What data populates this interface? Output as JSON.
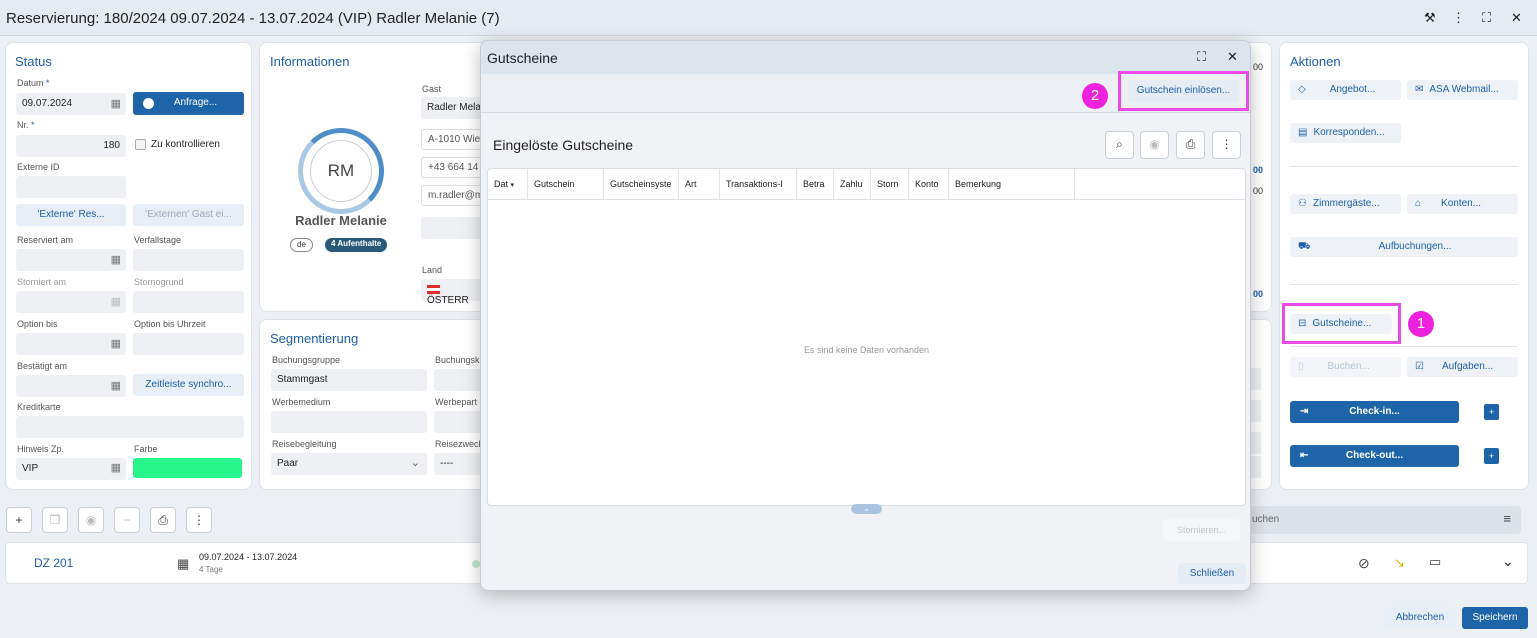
{
  "window": {
    "title": "Reservierung: 180/2024 09.07.2024 - 13.07.2024 (VIP) Radler Melanie (7)"
  },
  "status": {
    "title": "Status",
    "datum_label": "Datum",
    "datum": "09.07.2024",
    "anfrage": "Anfrage...",
    "nr_label": "Nr.",
    "nr": "180",
    "zu_kontrollieren": "Zu kontrollieren",
    "externe_id_label": "Externe ID",
    "externe_res": "'Externe' Res...",
    "externen_gast": "'Externen' Gast ei...",
    "reserviert_am": "Reserviert am",
    "verfallstage": "Verfallstage",
    "storniert_am": "Storniert am",
    "stornogrund": "Stornogrund",
    "option_bis": "Option bis",
    "option_bis_uhrzeit": "Option bis Uhrzeit",
    "bestaetigt_am": "Bestätigt am",
    "zeitleiste": "Zeitleiste synchro...",
    "kreditkarte": "Kreditkarte",
    "hinweis_zp": "Hinweis Zp.",
    "hinweis_value": "VIP",
    "farbe": "Farbe",
    "farbe_color": "#27f58a"
  },
  "info": {
    "title": "Informationen",
    "initials": "RM",
    "name": "Radler Melanie",
    "lang": "de",
    "stays": "4 Aufenthalte",
    "gast_label": "Gast",
    "gast_value": "Radler Mela",
    "address": "A-1010 Wie",
    "phone": "+43 664 14",
    "email": "m.radler@m",
    "land_label": "Land",
    "land_value": "ÖSTERR"
  },
  "segment": {
    "title": "Segmentierung",
    "buchungsgruppe_label": "Buchungsgruppe",
    "buchungsgruppe": "Stammgast",
    "buchungsk_label": "Buchungsk",
    "werbemedium_label": "Werbemedium",
    "werbepart_label": "Werbepart",
    "reisebegleitung_label": "Reisebegleitung",
    "reisebegleitung": "Paar",
    "reisezweck_label": "Reisezweck",
    "reisezweck": "----"
  },
  "partial_numbers": [
    "00",
    "00",
    "00",
    "00"
  ],
  "actions": {
    "title": "Aktionen",
    "angebot": "Angebot...",
    "asa_webmail": "ASA Webmail...",
    "korrespondenz": "Korresponden...",
    "zimmergaeste": "Zimmergäste...",
    "konten": "Konten...",
    "aufbuchungen": "Aufbuchungen...",
    "gutscheine": "Gutscheine...",
    "buchen": "Buchen...",
    "aufgaben": "Aufgaben...",
    "checkin": "Check-in...",
    "checkout": "Check-out..."
  },
  "annotations": {
    "badge1": "1",
    "badge2": "2"
  },
  "bottom": {
    "room": "DZ  201",
    "dates": "09.07.2024 - 13.07.2024",
    "days": "4 Tage",
    "search_partial": "uchen",
    "stornieren": "Stornieren...",
    "abbrechen": "Abbrechen",
    "speichern": "Speichern"
  },
  "modal": {
    "title": "Gutscheine",
    "einloesen": "Gutschein einlösen...",
    "section_title": "Eingelöste Gutscheine",
    "columns": [
      "Dat",
      "Gutschein",
      "Gutscheinsyste",
      "Art",
      "Transaktions-I",
      "Betra",
      "Zahlu",
      "Storn",
      "Konto",
      "Bemerkung"
    ],
    "empty": "Es sind keine Daten vorhanden",
    "close": "Schließen"
  },
  "colors": {
    "accent": "#1d64a8",
    "highlight": "#e94ce5",
    "badge": "#ee22dd"
  }
}
